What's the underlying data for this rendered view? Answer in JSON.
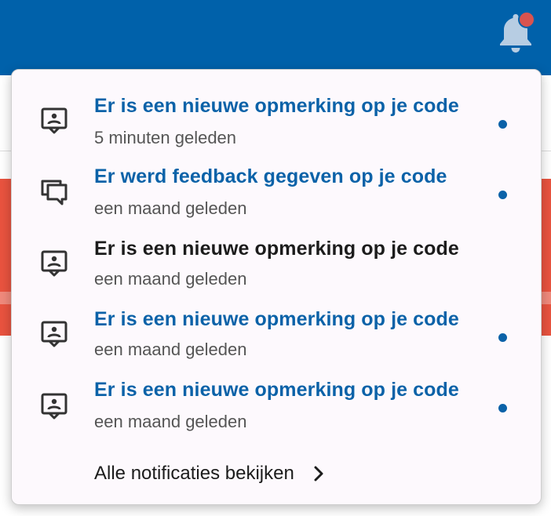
{
  "header": {
    "bell_icon": "bell-icon",
    "badge_color": "#d9534f",
    "bar_color": "#0061aa"
  },
  "notifications": {
    "items": [
      {
        "title": "Er is een nieuwe opmerking op je code",
        "time": "5 minuten geleden",
        "icon": "comment-icon",
        "unread": true
      },
      {
        "title": "Er werd feedback gegeven op je code",
        "time": "een maand geleden",
        "icon": "forum-icon",
        "unread": true
      },
      {
        "title": "Er is een nieuwe opmerking op je code",
        "time": "een maand geleden",
        "icon": "comment-icon",
        "unread": false
      },
      {
        "title": "Er is een nieuwe opmerking op je code",
        "time": "een maand geleden",
        "icon": "comment-icon",
        "unread": true
      },
      {
        "title": "Er is een nieuwe opmerking op je code",
        "time": "een maand geleden",
        "icon": "comment-icon",
        "unread": true
      }
    ],
    "view_all_label": "Alle notificaties bekijken",
    "accent_color": "#0b62a8"
  }
}
